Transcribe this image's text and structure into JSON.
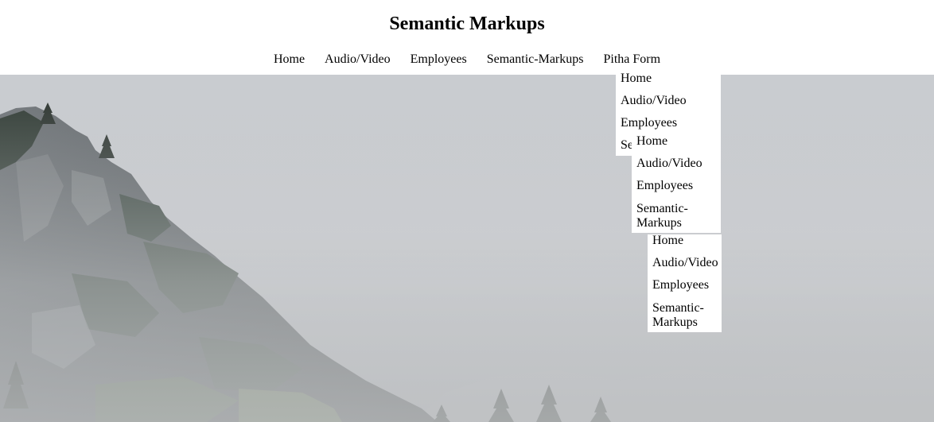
{
  "header": {
    "title": "Semantic Markups"
  },
  "nav": {
    "items": [
      "Home",
      "Audio/Video",
      "Employees",
      "Semantic-Markups",
      "Pitha Form"
    ]
  },
  "dropdowns": {
    "level1": {
      "items": [
        "Home",
        "Audio/Video",
        "Employees",
        "Se"
      ]
    },
    "level2": {
      "items": [
        "Home",
        "Audio/Video",
        "Employees",
        "Semantic-Markups"
      ]
    },
    "level3": {
      "items": [
        "Home",
        "Audio/Video",
        "Employees",
        "Semantic-Markups"
      ]
    }
  },
  "hero": {
    "image": "misty-mountain-landscape"
  }
}
